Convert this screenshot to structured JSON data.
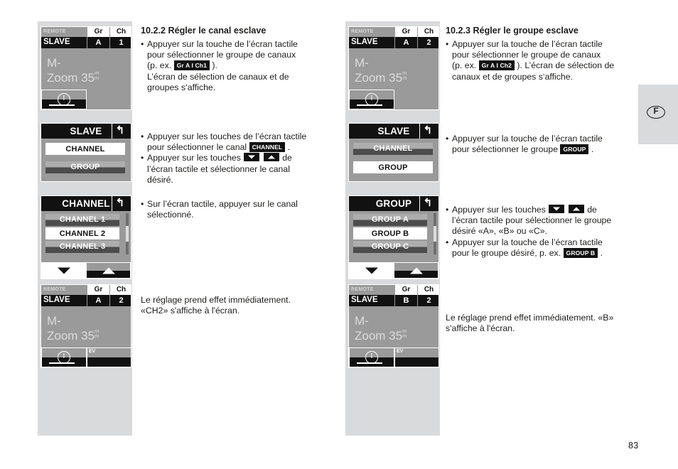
{
  "page": {
    "number": "83",
    "language_tab": "F"
  },
  "left_column": {
    "heading": "10.2.2 Régler le canal esclave",
    "screens": {
      "status_top": {
        "remote_label": "REMOTE",
        "mode_label": "SLAVE",
        "gr_header": "Gr",
        "gr_value": "A",
        "ch_header": "Ch",
        "ch_value": "1",
        "lens_line1": "M-",
        "lens_line2": "Zoom 35",
        "lens_unit_top": "m",
        "lens_unit_bottom": "m",
        "softkey_left_icon": "exposure-compensation-icon"
      },
      "menu_slave": {
        "title": "SLAVE",
        "back_icon": "back-arrow-icon",
        "items": [
          {
            "label": "CHANNEL",
            "selected": true
          },
          {
            "label": "GROUP",
            "selected": false
          }
        ]
      },
      "menu_channel": {
        "title": "CHANNEL",
        "back_icon": "back-arrow-icon",
        "items": [
          {
            "label": "CHANNEL 1",
            "selected": false
          },
          {
            "label": "CHANNEL 2",
            "selected": true
          },
          {
            "label": "CHANNEL 3",
            "selected": false
          }
        ],
        "arrow_down_icon": "arrow-down-icon",
        "arrow_up_icon": "arrow-up-icon"
      },
      "status_bottom": {
        "remote_label": "REMOTE",
        "mode_label": "SLAVE",
        "gr_header": "Gr",
        "gr_value": "A",
        "ch_header": "Ch",
        "ch_value": "2",
        "lens_line1": "M-",
        "lens_line2": "Zoom 35",
        "lens_unit_top": "m",
        "lens_unit_bottom": "m",
        "softkey_left_icon": "exposure-compensation-icon",
        "softkey_right_label": "EV"
      }
    },
    "text": {
      "b1_l1": "Appuyer sur la touche de l’écran tactile",
      "b1_l2": "pour sélectionner le groupe de canaux",
      "b1_l3_pre": "(p. ex.",
      "b1_badge": "Gr A I Ch1",
      "b1_l3_post": ").",
      "b1_l4": "L’écran de sélection de canaux et de",
      "b1_l5": "groupes s‘affiche.",
      "b2_l1": "Appuyer sur les touches de l’écran tactile",
      "b2_l2_pre": "pour sélectionner le canal",
      "b2_badge": "CHANNEL",
      "b2_l2_post": ".",
      "b3_l1_pre": "Appuyer sur les touches",
      "b3_l1_post": "de",
      "b3_l2": "l’écran tactile et sélectionner le canal",
      "b3_l3": "désiré.",
      "b4_l1": "Sur l’écran tactile, appuyer sur le canal",
      "b4_l2": "sélectionné.",
      "note_l1": "Le réglage prend effet immédiatement.",
      "note_l2": "«CH2» s'affiche à l'écran."
    }
  },
  "right_column": {
    "heading": "10.2.3 Régler le groupe esclave",
    "screens": {
      "status_top": {
        "remote_label": "REMOTE",
        "mode_label": "SLAVE",
        "gr_header": "Gr",
        "gr_value": "A",
        "ch_header": "Ch",
        "ch_value": "2",
        "lens_line1": "M-",
        "lens_line2": "Zoom 35",
        "lens_unit_top": "m",
        "lens_unit_bottom": "m",
        "softkey_left_icon": "exposure-compensation-icon"
      },
      "menu_slave": {
        "title": "SLAVE",
        "back_icon": "back-arrow-icon",
        "items": [
          {
            "label": "CHANNEL",
            "selected": false
          },
          {
            "label": "GROUP",
            "selected": true
          }
        ]
      },
      "menu_group": {
        "title": "GROUP",
        "back_icon": "back-arrow-icon",
        "items": [
          {
            "label": "GROUP A",
            "selected": false
          },
          {
            "label": "GROUP B",
            "selected": true
          },
          {
            "label": "GROUP C",
            "selected": false
          }
        ],
        "arrow_down_icon": "arrow-down-icon",
        "arrow_up_icon": "arrow-up-icon"
      },
      "status_bottom": {
        "remote_label": "REMOTE",
        "mode_label": "SLAVE",
        "gr_header": "Gr",
        "gr_value": "B",
        "ch_header": "Ch",
        "ch_value": "2",
        "lens_line1": "M-",
        "lens_line2": "Zoom 35",
        "lens_unit_top": "m",
        "lens_unit_bottom": "m",
        "softkey_left_icon": "exposure-compensation-icon",
        "softkey_right_label": "EV"
      }
    },
    "text": {
      "b1_l1": "Appuyer sur la touche de l’écran tactile",
      "b1_l2": "pour sélectionner le groupe de canaux",
      "b1_l3_pre": "(p. ex.",
      "b1_badge": "Gr A I Ch2",
      "b1_l3_post": "). L’écran de sélection de",
      "b1_l4": "canaux et de groupes s‘affiche.",
      "b2_l1": "Appuyer sur la touche de l’écran tactile",
      "b2_l2_pre": "pour sélectionner le groupe",
      "b2_badge": "GROUP",
      "b2_l2_post": ".",
      "b3_l1_pre": "Appuyer sur les touches",
      "b3_l1_post": "de",
      "b3_l2": "l’écran tactile pour sélectionner le groupe",
      "b3_l3": "désiré «A», «B» ou «C».",
      "b4_l1": "Appuyer sur la touche de l’écran tactile",
      "b4_l2_pre": "pour le groupe désiré, p. ex.",
      "b4_badge": "GROUP B",
      "b4_l2_post": ".",
      "note_l1": "Le réglage prend effet immédiatement. «B»",
      "note_l2": "s'affiche à l'écran."
    }
  }
}
